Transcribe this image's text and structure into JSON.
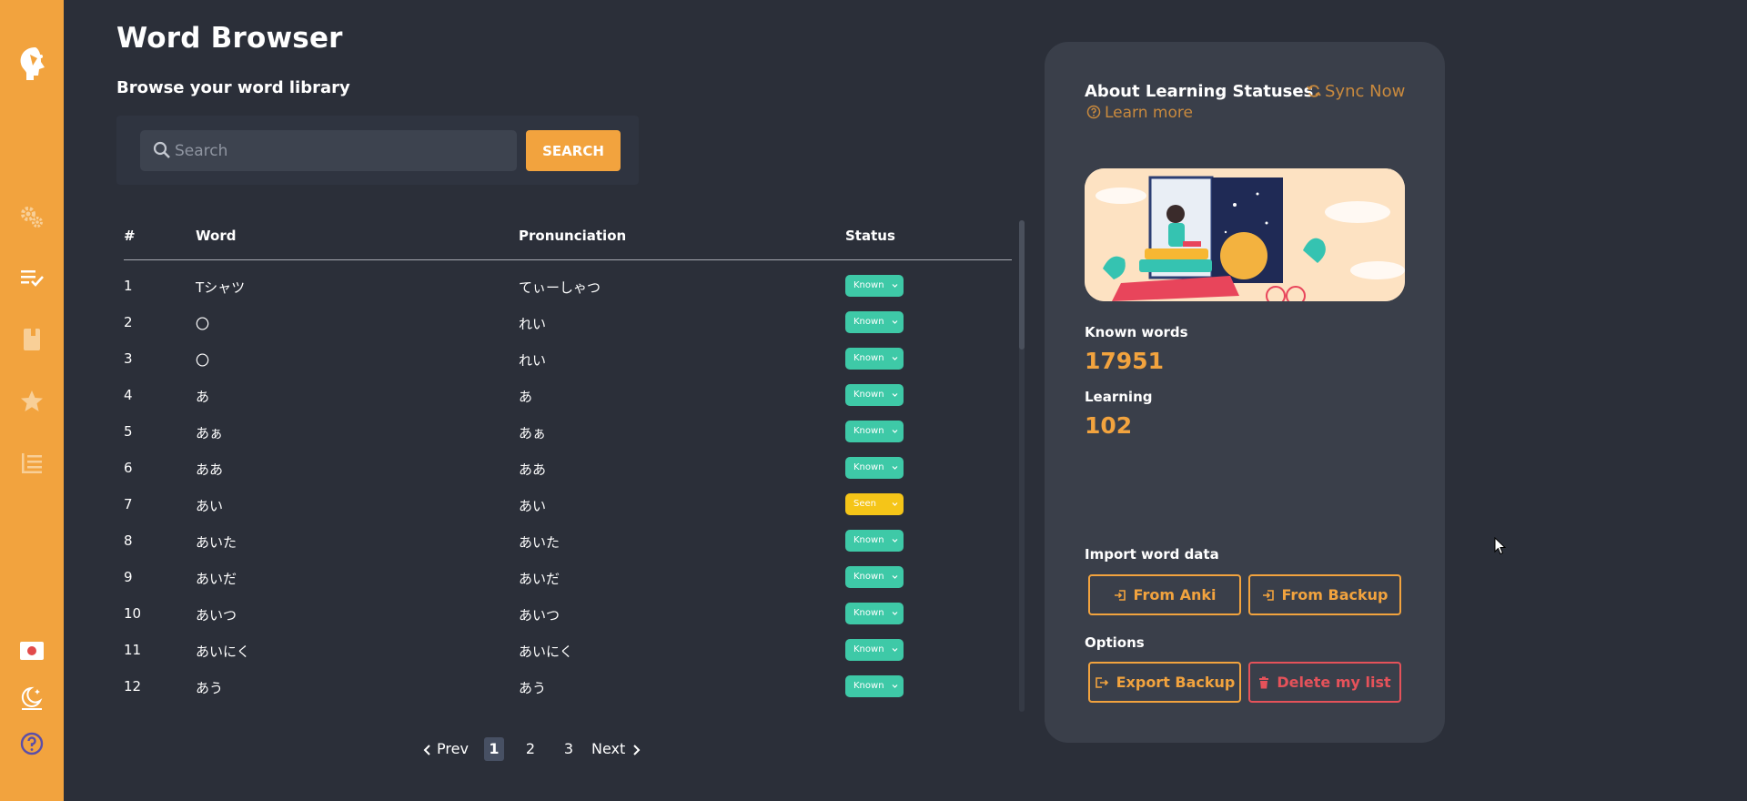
{
  "app": {
    "accent": "#f2a33e",
    "sidebar_icons": [
      "logo-head-icon",
      "settings-gears-icon",
      "checklist-icon",
      "book-icon",
      "star-icon",
      "list-icon",
      "japan-flag-icon",
      "theme-moon-icon",
      "help-icon"
    ]
  },
  "header": {
    "title": "Word Browser",
    "subtitle": "Browse your word library"
  },
  "search": {
    "placeholder": "Search",
    "value": "",
    "button_label": "SEARCH"
  },
  "table": {
    "columns": [
      "#",
      "Word",
      "Pronunciation",
      "Status"
    ],
    "rows": [
      {
        "num": "1",
        "word": "Tシャツ",
        "pron": "てぃーしゃつ",
        "status": "Known"
      },
      {
        "num": "2",
        "word": "〇",
        "pron": "れい",
        "status": "Known"
      },
      {
        "num": "3",
        "word": "〇",
        "pron": "れい",
        "status": "Known"
      },
      {
        "num": "4",
        "word": "あ",
        "pron": "あ",
        "status": "Known"
      },
      {
        "num": "5",
        "word": "あぁ",
        "pron": "あぁ",
        "status": "Known"
      },
      {
        "num": "6",
        "word": "ああ",
        "pron": "ああ",
        "status": "Known"
      },
      {
        "num": "7",
        "word": "あい",
        "pron": "あい",
        "status": "Seen"
      },
      {
        "num": "8",
        "word": "あいた",
        "pron": "あいた",
        "status": "Known"
      },
      {
        "num": "9",
        "word": "あいだ",
        "pron": "あいだ",
        "status": "Known"
      },
      {
        "num": "10",
        "word": "あいつ",
        "pron": "あいつ",
        "status": "Known"
      },
      {
        "num": "11",
        "word": "あいにく",
        "pron": "あいにく",
        "status": "Known"
      },
      {
        "num": "12",
        "word": "あう",
        "pron": "あう",
        "status": "Known"
      }
    ],
    "status_colors": {
      "Known": "#3ec9a7",
      "Seen": "#f5c518"
    }
  },
  "pagination": {
    "prev_label": "Prev",
    "next_label": "Next",
    "pages": [
      "1",
      "2",
      "3"
    ],
    "current": "1"
  },
  "panel": {
    "title": "About Learning Statuses",
    "sync_label": "Sync Now",
    "learn_more": "Learn more",
    "known_label": "Known words",
    "known_value": "17951",
    "learning_label": "Learning",
    "learning_value": "102",
    "import_label": "Import word data",
    "from_anki": "From Anki",
    "from_backup": "From Backup",
    "options_label": "Options",
    "export_backup": "Export Backup",
    "delete_list": "Delete my list",
    "danger_color": "#e5525a"
  }
}
